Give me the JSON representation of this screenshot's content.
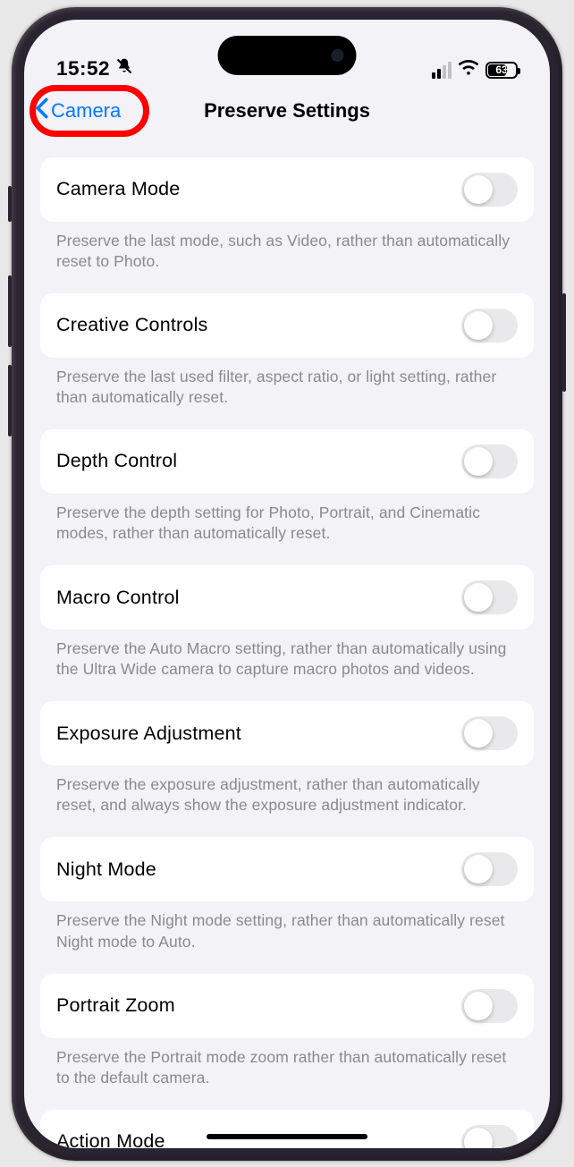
{
  "status": {
    "time": "15:52",
    "battery": "63"
  },
  "nav": {
    "back": "Camera",
    "title": "Preserve Settings"
  },
  "settings": [
    {
      "title": "Camera Mode",
      "desc": "Preserve the last mode, such as Video, rather than automatically reset to Photo."
    },
    {
      "title": "Creative Controls",
      "desc": "Preserve the last used filter, aspect ratio, or light setting, rather than automatically reset."
    },
    {
      "title": "Depth Control",
      "desc": "Preserve the depth setting for Photo, Portrait, and Cinematic modes, rather than automatically reset."
    },
    {
      "title": "Macro Control",
      "desc": "Preserve the Auto Macro setting, rather than automatically using the Ultra Wide camera to capture macro photos and videos."
    },
    {
      "title": "Exposure Adjustment",
      "desc": "Preserve the exposure adjustment, rather than automatically reset, and always show the exposure adjustment indicator."
    },
    {
      "title": "Night Mode",
      "desc": "Preserve the Night mode setting, rather than automatically reset Night mode to Auto."
    },
    {
      "title": "Portrait Zoom",
      "desc": "Preserve the Portrait mode zoom rather than automatically reset to the default camera."
    },
    {
      "title": "Action Mode",
      "desc": ""
    }
  ]
}
